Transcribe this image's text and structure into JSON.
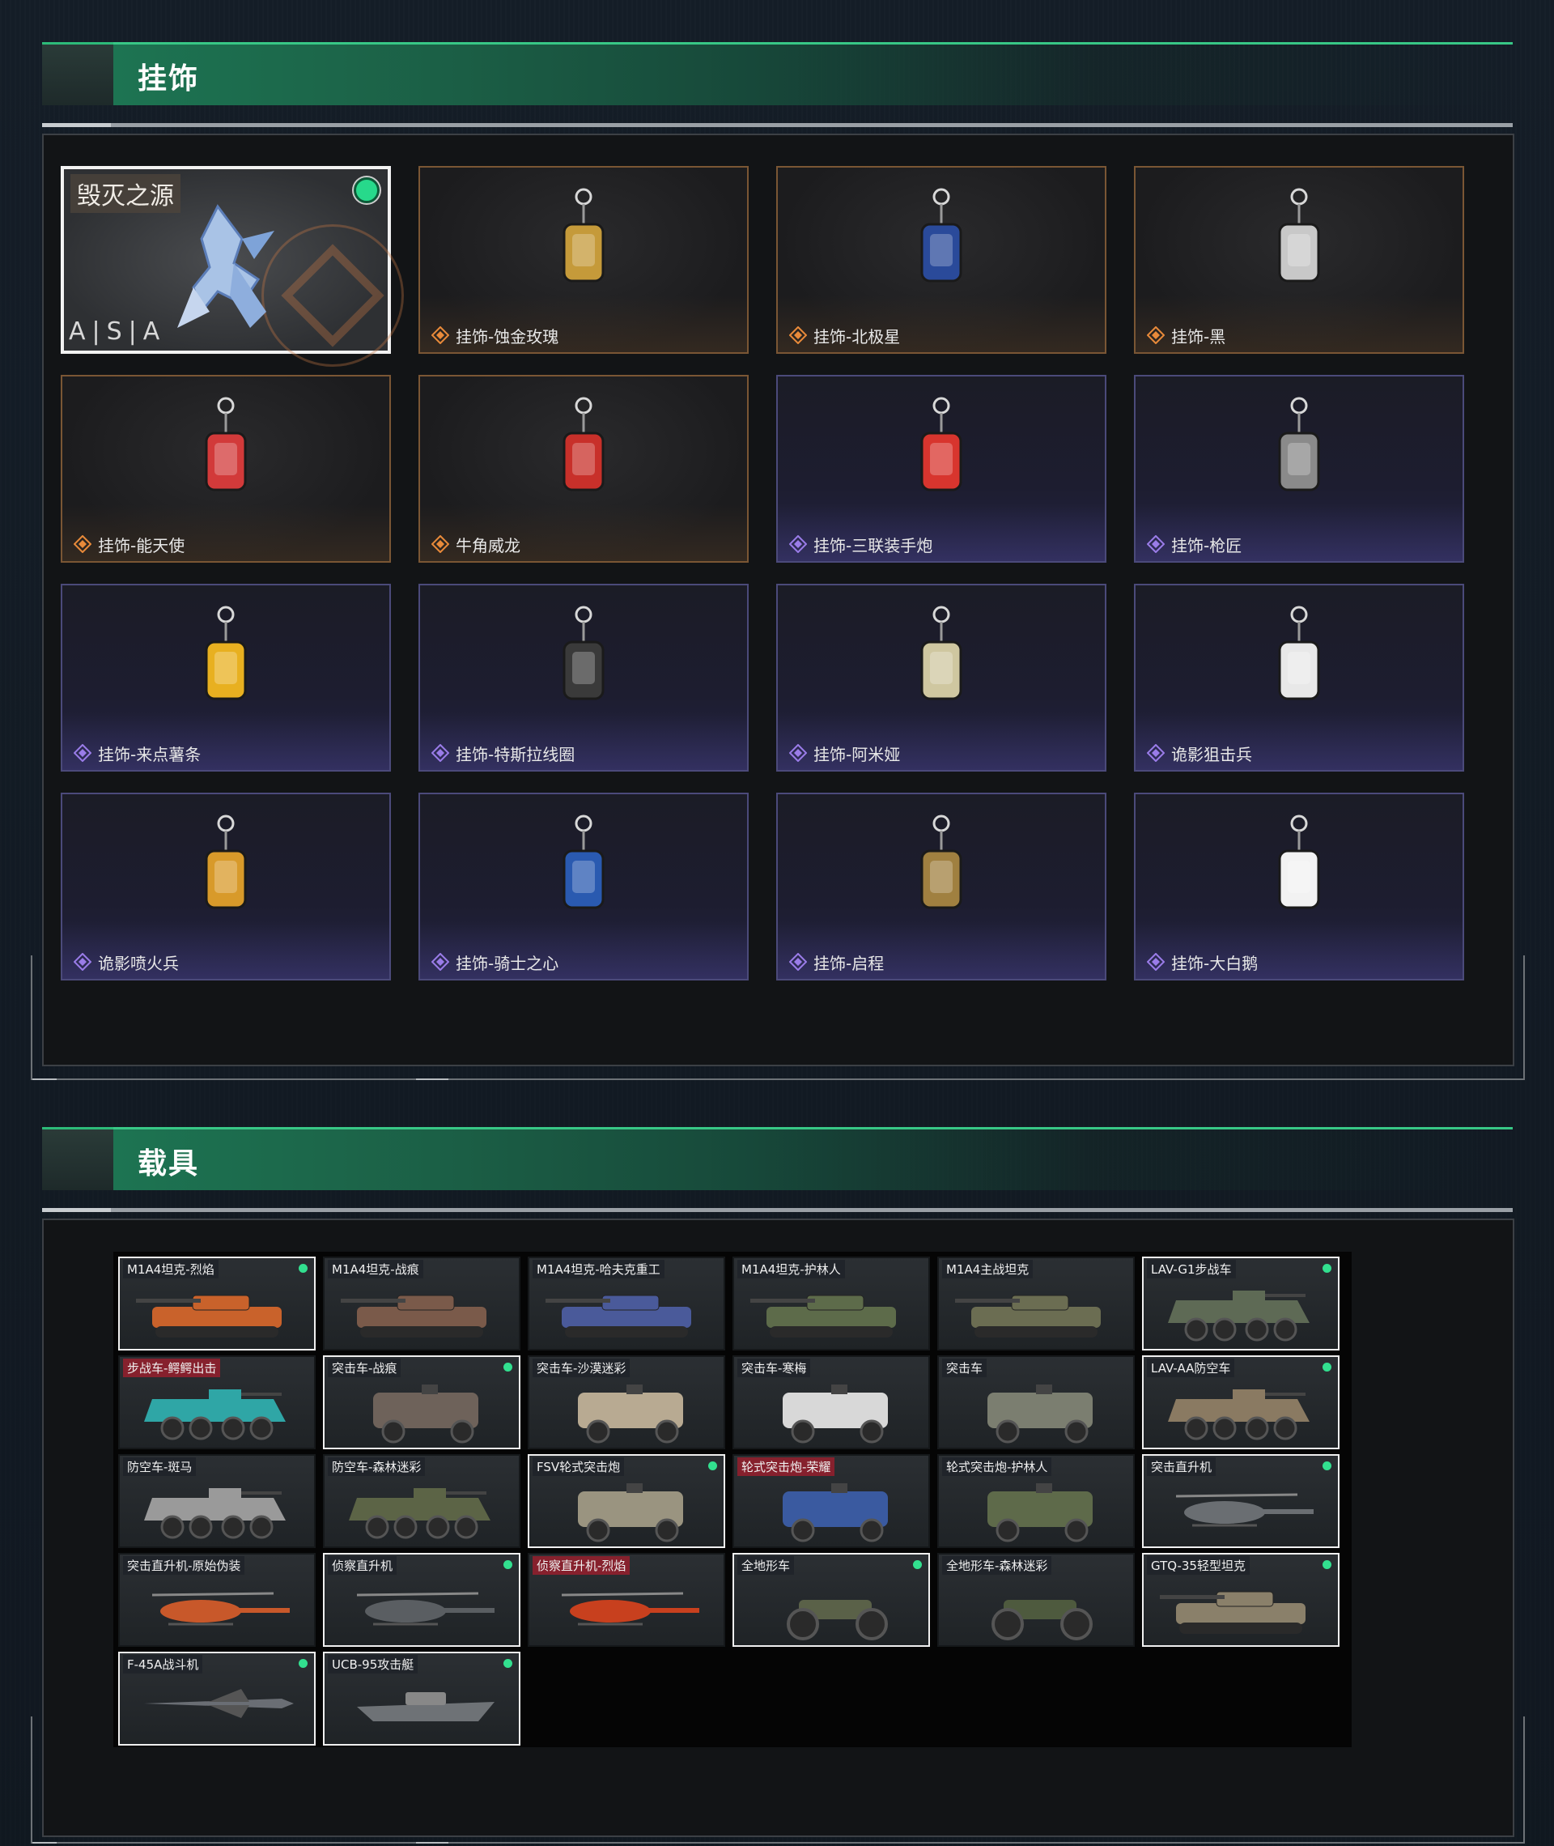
{
  "sections": {
    "charms_title": "挂饰",
    "vehicles_title": "载具"
  },
  "featured": {
    "title": "毁灭之源",
    "brand": "A|S|A"
  },
  "charms": [
    {
      "label": "挂饰-蚀金玫瑰",
      "rarity": "orange"
    },
    {
      "label": "挂饰-北极星",
      "rarity": "orange"
    },
    {
      "label": "挂饰-黑",
      "rarity": "orange"
    },
    {
      "label": "挂饰-能天使",
      "rarity": "orange"
    },
    {
      "label": "牛角威龙",
      "rarity": "orange"
    },
    {
      "label": "挂饰-三联装手炮",
      "rarity": "purple"
    },
    {
      "label": "挂饰-枪匠",
      "rarity": "purple"
    },
    {
      "label": "挂饰-来点薯条",
      "rarity": "purple"
    },
    {
      "label": "挂饰-特斯拉线圈",
      "rarity": "purple"
    },
    {
      "label": "挂饰-阿米娅",
      "rarity": "purple"
    },
    {
      "label": "诡影狙击兵",
      "rarity": "purple"
    },
    {
      "label": "诡影喷火兵",
      "rarity": "purple"
    },
    {
      "label": "挂饰-骑士之心",
      "rarity": "purple"
    },
    {
      "label": "挂饰-启程",
      "rarity": "purple"
    },
    {
      "label": "挂饰-大白鹅",
      "rarity": "purple"
    }
  ],
  "vehicles": [
    {
      "label": "M1A4坦克-烈焰",
      "kind": "tank",
      "sel": true,
      "dot": true,
      "red": false,
      "color": "#c9622b"
    },
    {
      "label": "M1A4坦克-战痕",
      "kind": "tank",
      "sel": false,
      "dot": false,
      "red": false,
      "color": "#7a5a4a"
    },
    {
      "label": "M1A4坦克-哈夫克重工",
      "kind": "tank",
      "sel": false,
      "dot": false,
      "red": false,
      "color": "#4a5a9a"
    },
    {
      "label": "M1A4坦克-护林人",
      "kind": "tank",
      "sel": false,
      "dot": false,
      "red": false,
      "color": "#5d6b4a"
    },
    {
      "label": "M1A4主战坦克",
      "kind": "tank",
      "sel": false,
      "dot": false,
      "red": false,
      "color": "#6b6d52"
    },
    {
      "label": "LAV-G1步战车",
      "kind": "apc",
      "sel": true,
      "dot": true,
      "red": false,
      "color": "#5e6a55"
    },
    {
      "label": "步战车-鳄鳄出击",
      "kind": "apc",
      "sel": false,
      "dot": false,
      "red": true,
      "color": "#2fa6a6"
    },
    {
      "label": "突击车-战痕",
      "kind": "truck",
      "sel": true,
      "dot": true,
      "red": false,
      "color": "#6e625a"
    },
    {
      "label": "突击车-沙漠迷彩",
      "kind": "truck",
      "sel": false,
      "dot": false,
      "red": false,
      "color": "#b8aa92"
    },
    {
      "label": "突击车-寒梅",
      "kind": "truck",
      "sel": false,
      "dot": false,
      "red": false,
      "color": "#d8d8d8"
    },
    {
      "label": "突击车",
      "kind": "truck",
      "sel": false,
      "dot": false,
      "red": false,
      "color": "#7b7e70"
    },
    {
      "label": "LAV-AA防空车",
      "kind": "apc",
      "sel": true,
      "dot": true,
      "red": false,
      "color": "#8a7a62"
    },
    {
      "label": "防空车-斑马",
      "kind": "apc",
      "sel": false,
      "dot": false,
      "red": false,
      "color": "#9a9a9a"
    },
    {
      "label": "防空车-森林迷彩",
      "kind": "apc",
      "sel": false,
      "dot": false,
      "red": false,
      "color": "#5c6446"
    },
    {
      "label": "FSV轮式突击炮",
      "kind": "truck",
      "sel": true,
      "dot": true,
      "red": false,
      "color": "#9a9480"
    },
    {
      "label": "轮式突击炮-荣耀",
      "kind": "truck",
      "sel": false,
      "dot": false,
      "red": true,
      "color": "#3a5aa0"
    },
    {
      "label": "轮式突击炮-护林人",
      "kind": "truck",
      "sel": false,
      "dot": false,
      "red": false,
      "color": "#5e6a4a"
    },
    {
      "label": "突击直升机",
      "kind": "heli",
      "sel": true,
      "dot": true,
      "red": false,
      "color": "#6a6e72"
    },
    {
      "label": "突击直升机-原始伪装",
      "kind": "heli",
      "sel": false,
      "dot": false,
      "red": false,
      "color": "#c8582a"
    },
    {
      "label": "侦察直升机",
      "kind": "heli",
      "sel": true,
      "dot": true,
      "red": false,
      "color": "#5a5e62"
    },
    {
      "label": "侦察直升机-烈焰",
      "kind": "heli",
      "sel": false,
      "dot": false,
      "red": true,
      "color": "#c8401e"
    },
    {
      "label": "全地形车",
      "kind": "atv",
      "sel": true,
      "dot": true,
      "red": false,
      "color": "#5a6148"
    },
    {
      "label": "全地形车-森林迷彩",
      "kind": "atv",
      "sel": false,
      "dot": false,
      "red": false,
      "color": "#4e5a3e"
    },
    {
      "label": "GTQ-35轻型坦克",
      "kind": "tank",
      "sel": true,
      "dot": true,
      "red": false,
      "color": "#8a806a"
    },
    {
      "label": "F-45A战斗机",
      "kind": "jet",
      "sel": true,
      "dot": true,
      "red": false,
      "color": "#6a6e74"
    },
    {
      "label": "UCB-95攻击艇",
      "kind": "boat",
      "sel": true,
      "dot": true,
      "red": false,
      "color": "#6e7276"
    }
  ]
}
